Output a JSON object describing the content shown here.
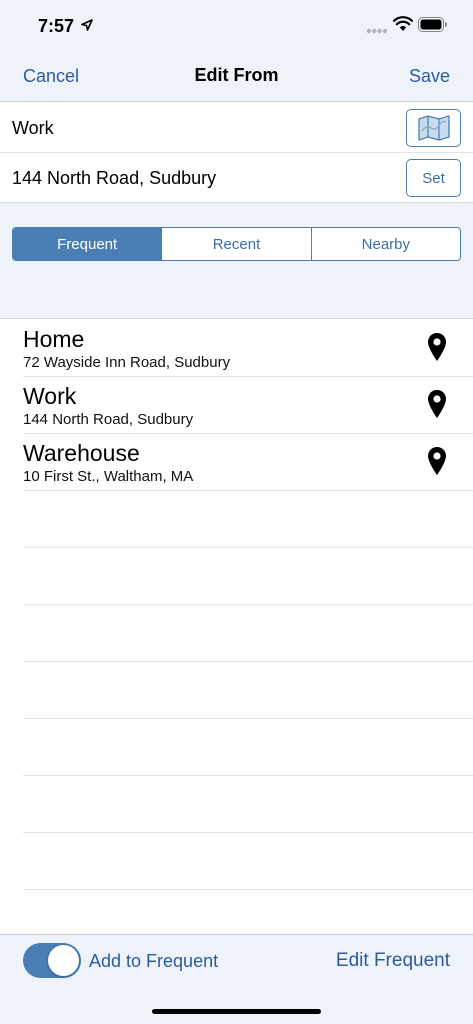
{
  "status_bar": {
    "time": "7:57"
  },
  "nav": {
    "cancel": "Cancel",
    "title": "Edit From",
    "save": "Save"
  },
  "form": {
    "name_value": "Work",
    "address_value": "144 North Road, Sudbury",
    "set_label": "Set"
  },
  "segments": {
    "items": [
      "Frequent",
      "Recent",
      "Nearby"
    ],
    "selected": "Frequent"
  },
  "places": [
    {
      "name": "Home",
      "address": "72 Wayside Inn Road, Sudbury"
    },
    {
      "name": "Work",
      "address": "144 North Road, Sudbury"
    },
    {
      "name": "Warehouse",
      "address": "10 First St., Waltham, MA"
    }
  ],
  "bottom": {
    "toggle_on": true,
    "toggle_label": "Add to Frequent",
    "edit_frequent": "Edit Frequent"
  },
  "colors": {
    "accent": "#4a7fb5",
    "link": "#2e5b9a",
    "bar_bg": "#eef3fa"
  },
  "icons": [
    "location-arrow-icon",
    "signal-icon",
    "wifi-icon",
    "battery-icon",
    "map-icon",
    "map-pin-icon"
  ]
}
